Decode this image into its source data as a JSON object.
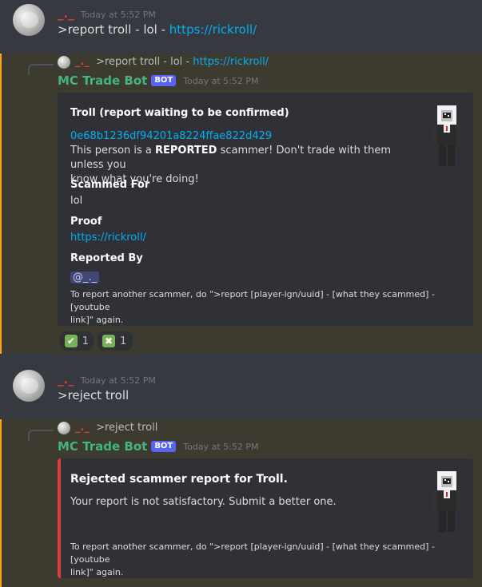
{
  "messages": [
    {
      "author": "_._",
      "timestamp": "Today at 5:52 PM",
      "content_prefix": ">report troll - lol - ",
      "content_link": "https://rickroll/"
    },
    {
      "reply_author": "_._",
      "reply_prefix": ">report troll - lol - ",
      "reply_link": "https://rickroll/",
      "bot_name": "MC Trade Bot",
      "bot_badge": "BOT",
      "timestamp": "Today at 5:52 PM",
      "embed": {
        "title": "Troll (report waiting to be confirmed)",
        "uuid_link": "0e68b1236df94201a8224ffae822d429",
        "desc_pre": "This person is a ",
        "desc_bold": "REPORTED",
        "desc_post_line1": " scammer! Don't trade with them unless you",
        "desc_line2": "know what you're doing!",
        "fields": [
          {
            "name": "Scammed For",
            "value": "lol"
          },
          {
            "name": "Proof",
            "value": "https://rickroll/"
          },
          {
            "name": "Reported By",
            "value": "@_._"
          }
        ],
        "footer_line1": "To report another scammer, do \">report [player-ign/uuid] - [what they scammed] - [youtube",
        "footer_line2": "link]\" again."
      },
      "reactions": [
        {
          "emoji": "check-mark",
          "glyph": "✔",
          "color": "#77b255",
          "count": "1"
        },
        {
          "emoji": "cross-mark",
          "glyph": "✖",
          "color": "#77b255",
          "count": "1"
        }
      ]
    },
    {
      "author": "_._",
      "timestamp": "Today at 5:52 PM",
      "content": ">reject troll"
    },
    {
      "reply_author": "_._",
      "reply_text": ">reject troll",
      "bot_name": "MC Trade Bot",
      "bot_badge": "BOT",
      "timestamp": "Today at 5:52 PM",
      "embed": {
        "title": "Rejected scammer report for Troll.",
        "desc": "Your report is not satisfactory. Submit a better one.",
        "footer_line1": "To report another scammer, do \">report [player-ign/uuid] - [what they scammed] - [youtube",
        "footer_line2": "link]\" again."
      }
    }
  ],
  "colors": {
    "background": "#36393f",
    "embed": "#2f3136",
    "highlight": "#3d3b2f",
    "highlight_bar": "#faa61a",
    "link": "#00b0f4",
    "bot_name": "#43b581",
    "username": "#e03c3c",
    "reject_bar": "#e03c3c"
  }
}
